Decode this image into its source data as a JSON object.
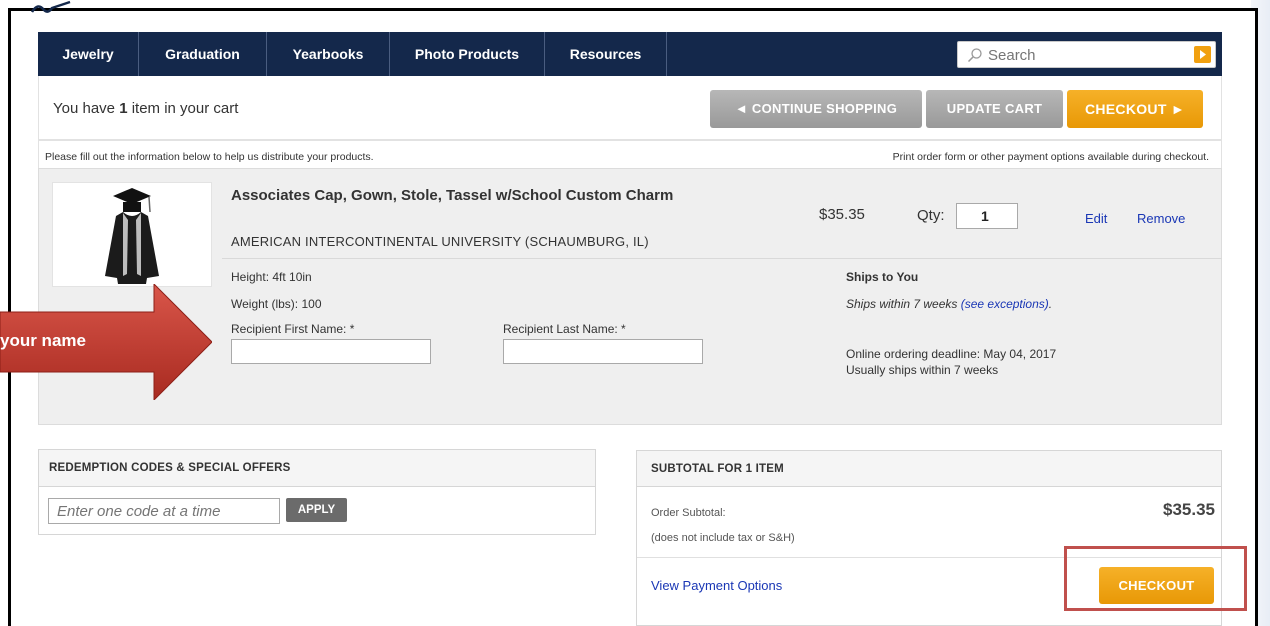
{
  "nav": {
    "items": [
      "Jewelry",
      "Graduation",
      "Yearbooks",
      "Photo Products",
      "Resources"
    ],
    "search_placeholder": "Search"
  },
  "cart": {
    "count_prefix": "You have ",
    "count": "1",
    "count_suffix": " item in your cart",
    "continue_label": "◄ CONTINUE SHOPPING",
    "update_label": "UPDATE CART",
    "checkout_label": "CHECKOUT ►"
  },
  "info": {
    "left": "Please fill out the information below to help us distribute your products.",
    "right": "Print order form or other payment options available during checkout."
  },
  "item": {
    "title": "Associates Cap, Gown, Stole, Tassel w/School Custom Charm",
    "school": "AMERICAN INTERCONTINENTAL UNIVERSITY (SCHAUMBURG, IL)",
    "price": "$35.35",
    "qty_label": "Qty:",
    "qty": "1",
    "edit": "Edit",
    "remove": "Remove",
    "height": "Height: 4ft 10in",
    "weight": "Weight (lbs): 100",
    "first_name_label": "Recipient First Name: *",
    "last_name_label": "Recipient Last Name: *",
    "ships_heading": "Ships to You",
    "ships_text": "Ships within 7 weeks ",
    "ships_link": "(see exceptions)",
    "ships_period": ".",
    "deadline": "Online ordering deadline: May 04, 2017",
    "usually": "Usually ships within 7 weeks"
  },
  "redemption": {
    "heading": "REDEMPTION CODES & SPECIAL OFFERS",
    "placeholder": "Enter one code at a time",
    "apply": "APPLY"
  },
  "summary": {
    "heading": "SUBTOTAL FOR 1 ITEM",
    "subtotal_label": "Order Subtotal:",
    "subtotal_value": "$35.35",
    "note": "(does not include tax or S&H)",
    "payment_link": "View Payment Options",
    "checkout": "CHECKOUT"
  },
  "annotation": {
    "arrow_text": "your name",
    "arrow_color": "#c0392b",
    "highlight_color": "#c0504d"
  },
  "colors": {
    "nav_bg": "#14284b",
    "orange": "#f1a00f",
    "grey_button": "#a6a6a6",
    "link": "#1a37b5"
  }
}
